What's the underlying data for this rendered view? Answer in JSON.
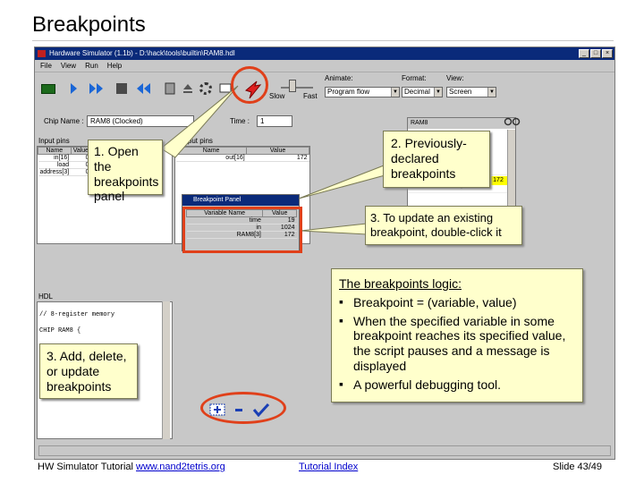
{
  "slide": {
    "title": "Breakpoints",
    "footer_left_text": "HW Simulator Tutorial ",
    "footer_left_link": "www.nand2tetris.org",
    "footer_center_link": "Tutorial Index",
    "footer_right": "Slide 43/49"
  },
  "window": {
    "title": "Hardware Simulator (1.1b) - D:\\hack\\tools\\builtin\\RAM8.hdl",
    "menu": [
      "File",
      "View",
      "Run",
      "Help"
    ],
    "slow_label": "Slow",
    "fast_label": "Fast",
    "animate_label": "Animate:",
    "animate_value": "Program flow",
    "format_label": "Format:",
    "format_value": "Decimal",
    "view_label": "View:",
    "view_value": "Screen",
    "chip_name_label": "Chip Name :",
    "chip_name_value": "RAM8 (Clocked)",
    "time_label": "Time :",
    "time_value": "1",
    "input_pins_title": "Input pins",
    "output_pins_title": "Output pins",
    "hdl_title": "HDL",
    "ram_title": "RAM8",
    "hdl_lines": [
      "// 8-register memory",
      "CHIP RAM8 {"
    ],
    "input_pins": {
      "headers": [
        "Name",
        "Value"
      ],
      "rows": [
        [
          "in[16]",
          "0"
        ],
        [
          "load",
          "0"
        ],
        [
          "address[3]",
          "0"
        ]
      ]
    },
    "output_pins": {
      "headers": [
        "Name",
        "Value"
      ],
      "rows": [
        [
          "out[16]",
          "172"
        ]
      ]
    },
    "ram_rows": [
      "0",
      "0",
      "0",
      "0",
      "0",
      "0",
      "0"
    ],
    "ram_highlight_value": "172"
  },
  "breakpoint_panel": {
    "title": "Breakpoint Panel",
    "headers": [
      "Variable Name",
      "Value"
    ],
    "rows": [
      [
        "time",
        "19"
      ],
      [
        "in",
        "1024"
      ],
      [
        "RAM8[3]",
        "172"
      ]
    ]
  },
  "callouts": {
    "open_panel": "1. Open the breakpoints panel",
    "previously_declared": "2. Previously-declared breakpoints",
    "update_existing": "3. To update an existing breakpoint, double-click it",
    "add_delete": "3. Add, delete, or update breakpoints",
    "logic_title": "The breakpoints logic:",
    "logic_bullets": [
      "Breakpoint = (variable, value)",
      "When the specified variable in some breakpoint reaches its specified value, the script pauses and a message is displayed",
      "A powerful debugging tool."
    ]
  },
  "colors": {
    "highlight": "#e0401a",
    "callout_bg": "#ffffcc",
    "titlebar": "#0a2a7a",
    "link": "#0000cc"
  },
  "icons": [
    "chip-icon",
    "single-step-icon",
    "fast-forward-icon",
    "stop-icon",
    "rewind-icon",
    "calculator-icon",
    "eject-icon",
    "gear-icon",
    "breakpoints-flag-icon",
    "add-breakpoint-icon",
    "remove-breakpoint-icon",
    "ok-check-icon"
  ]
}
